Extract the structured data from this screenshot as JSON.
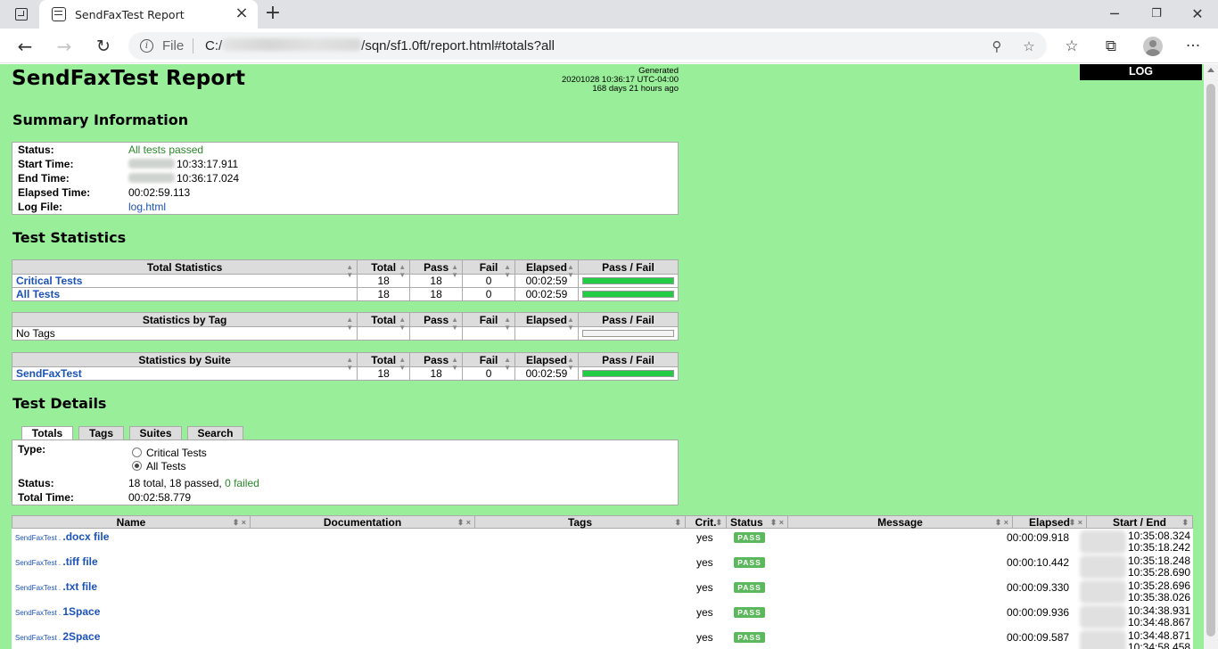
{
  "browser": {
    "tab_title": "SendFaxTest Report",
    "url_scheme": "File",
    "url_prefix": "C:/",
    "url_suffix": "/sqn/sf1.0ft/report.html#totals?all"
  },
  "report": {
    "title": "SendFaxTest Report",
    "generated_label": "Generated",
    "generated_time": "20201028 10:36:17 UTC-04:00",
    "generated_ago": "168 days 21 hours ago",
    "log_label": "LOG"
  },
  "summary": {
    "heading": "Summary Information",
    "rows": [
      {
        "key": "Status:",
        "value": "All tests passed"
      },
      {
        "key": "Start Time:",
        "value": "10:33:17.911"
      },
      {
        "key": "End Time:",
        "value": "10:36:17.024"
      },
      {
        "key": "Elapsed Time:",
        "value": "00:02:59.113"
      },
      {
        "key": "Log File:",
        "value": "log.html"
      }
    ]
  },
  "statistics": {
    "heading": "Test Statistics",
    "columns": [
      "Total",
      "Pass",
      "Fail",
      "Elapsed",
      "Pass / Fail"
    ],
    "total": {
      "title": "Total Statistics",
      "rows": [
        {
          "name": "Critical Tests",
          "total": "18",
          "pass": "18",
          "fail": "0",
          "elapsed": "00:02:59",
          "pass_ratio": 1
        },
        {
          "name": "All Tests",
          "total": "18",
          "pass": "18",
          "fail": "0",
          "elapsed": "00:02:59",
          "pass_ratio": 1
        }
      ]
    },
    "tag": {
      "title": "Statistics by Tag",
      "rows": [
        {
          "name": "No Tags"
        }
      ]
    },
    "suite": {
      "title": "Statistics by Suite",
      "rows": [
        {
          "name": "SendFaxTest",
          "total": "18",
          "pass": "18",
          "fail": "0",
          "elapsed": "00:02:59",
          "pass_ratio": 1
        }
      ]
    }
  },
  "details": {
    "heading": "Test Details",
    "tabs": [
      "Totals",
      "Tags",
      "Suites",
      "Search"
    ],
    "type_label": "Type:",
    "options": [
      "Critical Tests",
      "All Tests"
    ],
    "status_label": "Status:",
    "status_value": "18 total, 18 passed,",
    "status_failed": "0 failed",
    "total_time_label": "Total Time:",
    "total_time_value": "00:02:58.779",
    "columns": [
      "Name",
      "Documentation",
      "Tags",
      "Crit.",
      "Status",
      "Message",
      "Elapsed",
      "Start / End"
    ],
    "rows": [
      {
        "parent": "SendFaxTest . ",
        "name": ".docx file",
        "crit": "yes",
        "status": "PASS",
        "elapsed": "00:00:09.918",
        "start": "10:35:08.324",
        "end": "10:35:18.242"
      },
      {
        "parent": "SendFaxTest . ",
        "name": ".tiff file",
        "crit": "yes",
        "status": "PASS",
        "elapsed": "00:00:10.442",
        "start": "10:35:18.248",
        "end": "10:35:28.690"
      },
      {
        "parent": "SendFaxTest . ",
        "name": ".txt file",
        "crit": "yes",
        "status": "PASS",
        "elapsed": "00:00:09.330",
        "start": "10:35:28.696",
        "end": "10:35:38.026"
      },
      {
        "parent": "SendFaxTest . ",
        "name": "1Space",
        "crit": "yes",
        "status": "PASS",
        "elapsed": "00:00:09.936",
        "start": "10:34:38.931",
        "end": "10:34:48.867"
      },
      {
        "parent": "SendFaxTest . ",
        "name": "2Space",
        "crit": "yes",
        "status": "PASS",
        "elapsed": "00:00:09.587",
        "start": "10:34:48.871",
        "end": "10:34:58.458"
      }
    ]
  },
  "colors": {
    "page_bg": "#99ee99",
    "pass": "#22cc44",
    "link": "#1a52b8",
    "badge": "#5cb85c"
  }
}
